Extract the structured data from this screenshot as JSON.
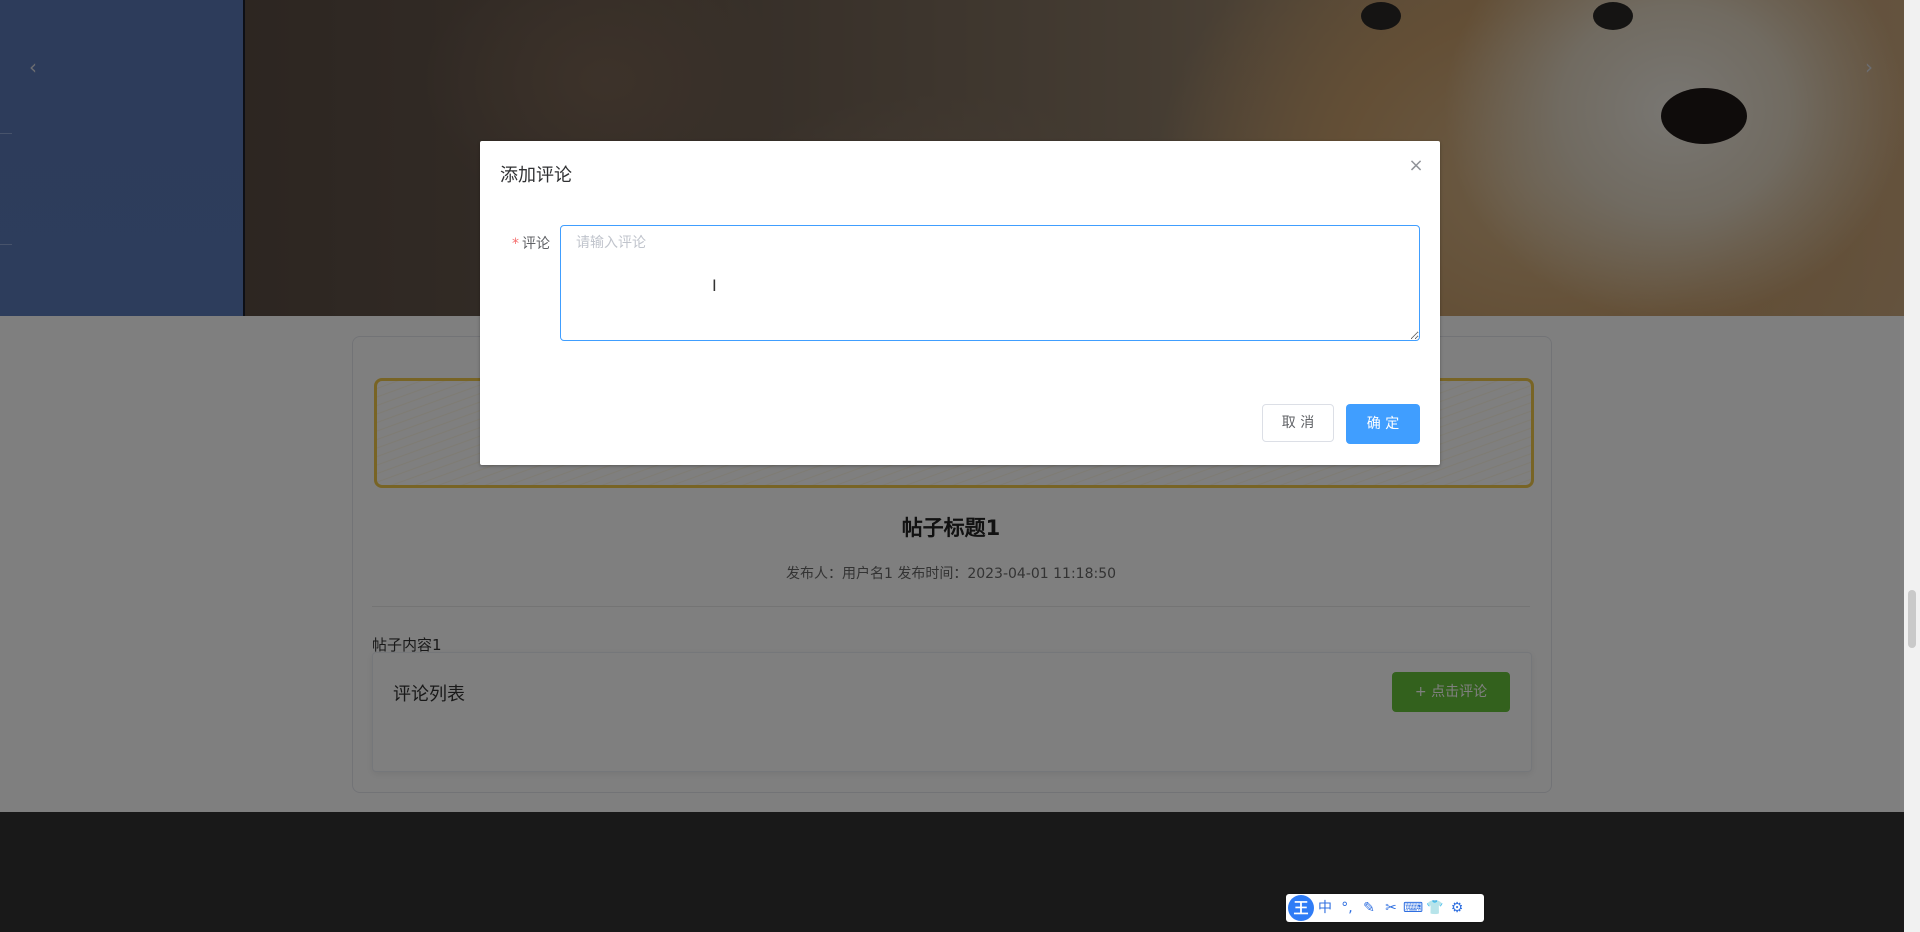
{
  "banner": {
    "prev_arrow": "‹",
    "next_arrow": "›"
  },
  "post": {
    "title": "帖子标题1",
    "meta": "发布人：用户名1  发布时间：2023-04-01 11:18:50",
    "content": "帖子内容1"
  },
  "comments": {
    "title": "评论列表",
    "add_button": "+ 点击评论"
  },
  "dialog": {
    "title": "添加评论",
    "close": "×",
    "label": "评论",
    "required_mark": "*",
    "placeholder": "请输入评论",
    "cancel": "取 消",
    "confirm": "确 定"
  },
  "ime": {
    "logo": "王",
    "items": [
      "中",
      "°,",
      "✎",
      "✂",
      "⌨",
      "👕",
      "⚙"
    ]
  },
  "colors": {
    "primary": "#409eff",
    "success": "#67c23a",
    "danger": "#f56c6c",
    "footer": "#333333",
    "deco_border": "#f1c94b"
  }
}
